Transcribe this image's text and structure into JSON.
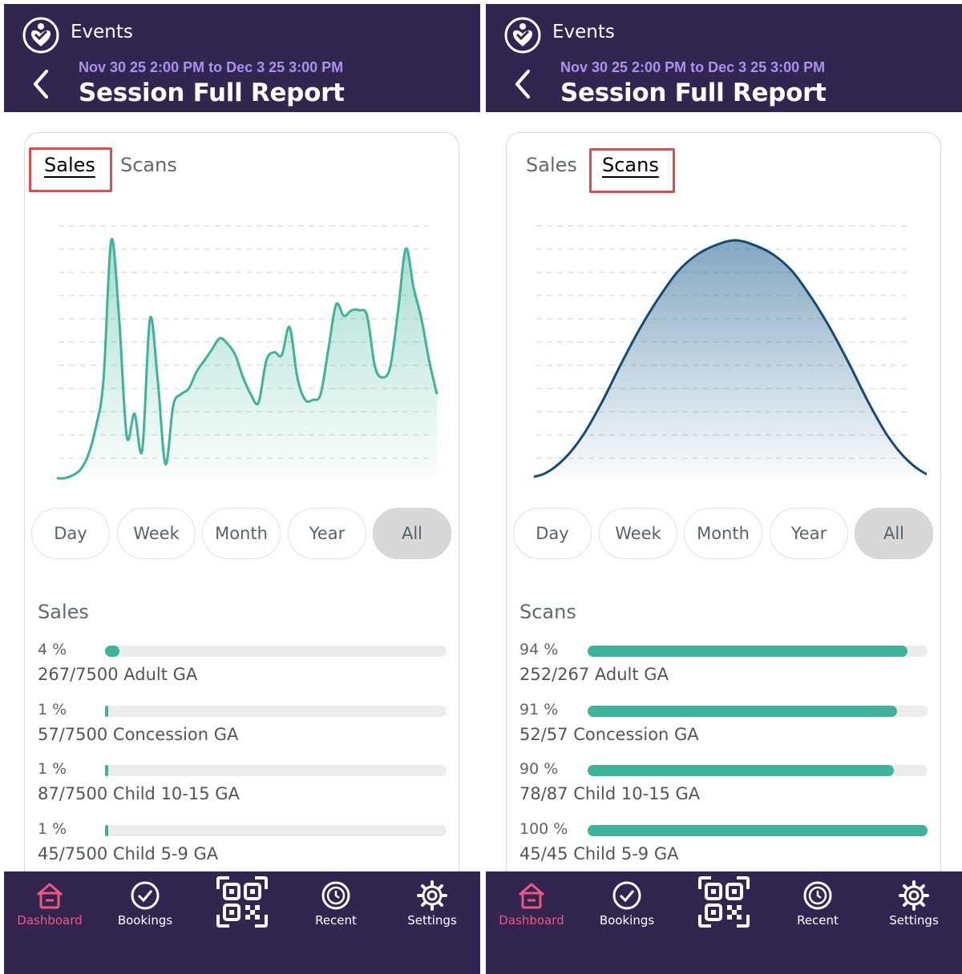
{
  "colors": {
    "header_bg": "#322651",
    "accent_green": "#3db399",
    "scan_line": "#134b78",
    "dashboard_active": "#f0577b",
    "highlight": "#e04b4f",
    "subtitle": "#a992ea"
  },
  "header": {
    "brand": "Events",
    "date_range": "Nov 30 25 2:00 PM to Dec 3 25 3:00 PM",
    "title": "Session Full Report"
  },
  "tabs": [
    "Sales",
    "Scans"
  ],
  "ranges": [
    "Day",
    "Week",
    "Month",
    "Year",
    "All"
  ],
  "selected_range": "All",
  "nav": [
    {
      "label": "Dashboard",
      "icon": "home-icon",
      "active": true
    },
    {
      "label": "Bookings",
      "icon": "check-circle-icon",
      "active": false
    },
    {
      "label": "",
      "icon": "qr-code-icon",
      "active": false
    },
    {
      "label": "Recent",
      "icon": "history-icon",
      "active": false
    },
    {
      "label": "Settings",
      "icon": "gear-icon",
      "active": false
    }
  ],
  "sales_view": {
    "active_tab": "Sales",
    "section_title": "Sales",
    "items": [
      {
        "pct_label": "4 %",
        "pct": 4,
        "label": "267/7500 Adult GA"
      },
      {
        "pct_label": "1 %",
        "pct": 1,
        "label": "57/7500 Concession GA"
      },
      {
        "pct_label": "1 %",
        "pct": 1,
        "label": "87/7500 Child 10-15 GA"
      },
      {
        "pct_label": "1 %",
        "pct": 1,
        "label": "45/7500 Child 5-9 GA"
      }
    ]
  },
  "scans_view": {
    "active_tab": "Scans",
    "section_title": "Scans",
    "items": [
      {
        "pct_label": "94 %",
        "pct": 94,
        "label": "252/267 Adult GA"
      },
      {
        "pct_label": "91 %",
        "pct": 91,
        "label": "52/57 Concession GA"
      },
      {
        "pct_label": "90 %",
        "pct": 90,
        "label": "78/87 Child 10-15 GA"
      },
      {
        "pct_label": "100 %",
        "pct": 100,
        "label": "45/45 Child 5-9 GA"
      }
    ]
  },
  "chart_data": [
    {
      "type": "area",
      "series": [
        {
          "values": [
            0,
            0,
            1,
            3,
            8,
            18,
            35,
            85,
            58,
            15,
            23,
            10,
            57,
            35,
            5,
            26,
            30,
            32,
            38,
            42,
            46,
            50,
            48,
            44,
            36,
            30,
            27,
            42,
            45,
            44,
            54,
            36,
            28,
            28,
            30,
            46,
            62,
            58,
            60,
            60,
            58,
            40,
            36,
            40,
            60,
            82,
            68,
            57,
            42,
            30
          ]
        }
      ],
      "grid": true
    },
    {
      "type": "area",
      "series": [
        {
          "values": [
            0,
            2,
            8,
            18,
            32,
            48,
            63,
            76,
            87,
            94,
            98,
            100,
            98,
            94,
            87,
            76,
            63,
            48,
            32,
            18,
            8,
            2,
            0
          ]
        }
      ],
      "grid": true
    }
  ]
}
